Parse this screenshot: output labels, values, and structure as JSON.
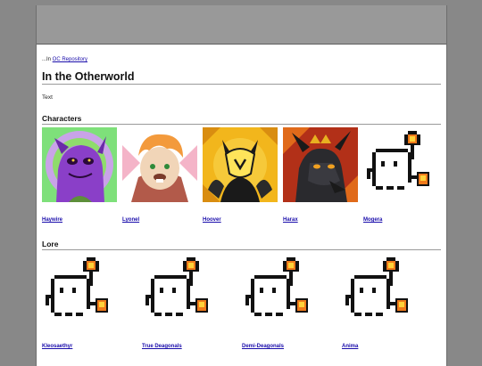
{
  "breadcrumb": {
    "prefix": "...In ",
    "link": "OC Repository"
  },
  "page_title": "In the Otherworld",
  "body_text": "Text",
  "sections": {
    "characters": {
      "heading": "Characters",
      "items": [
        {
          "name": "Haywire",
          "art": "purple-creature"
        },
        {
          "name": "Lyonel",
          "art": "orange-haired-character"
        },
        {
          "name": "Hoover",
          "art": "yellow-masked-character"
        },
        {
          "name": "Harax",
          "art": "black-dragon"
        },
        {
          "name": "Mogera",
          "art": "pixel-ghost-torch"
        }
      ]
    },
    "lore": {
      "heading": "Lore",
      "items": [
        {
          "name": "Kleosaethyr",
          "art": "pixel-ghost-torch"
        },
        {
          "name": "True Deagonals",
          "art": "pixel-ghost-torch"
        },
        {
          "name": "Demi-Deagonals",
          "art": "pixel-ghost-torch"
        },
        {
          "name": "Anima",
          "art": "pixel-ghost-torch"
        }
      ]
    }
  }
}
